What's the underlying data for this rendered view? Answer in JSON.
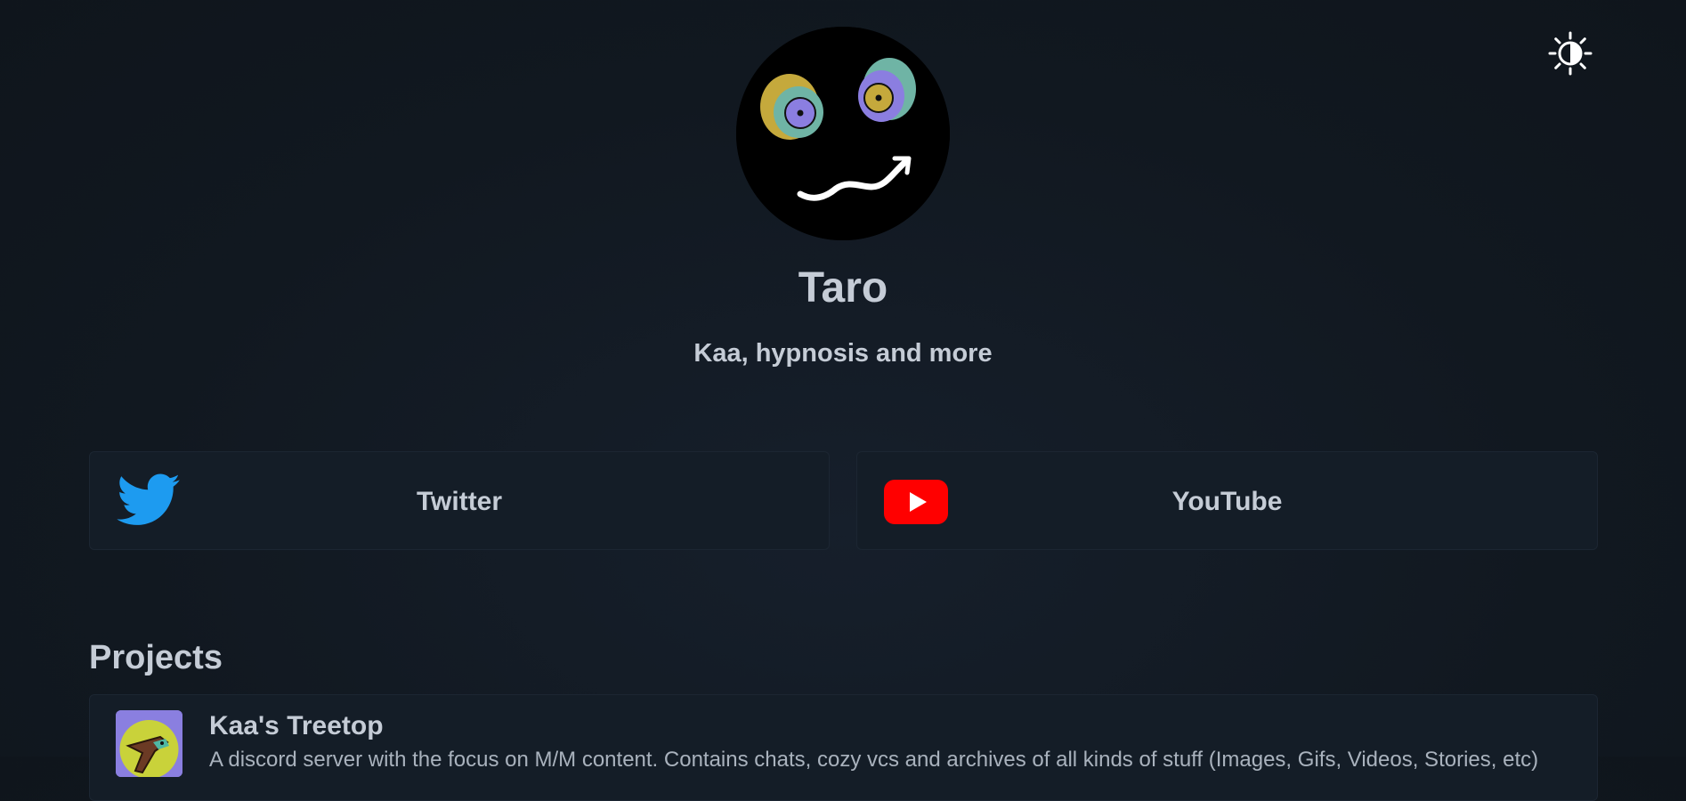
{
  "profile": {
    "name": "Taro",
    "tagline": "Kaa, hypnosis and more",
    "avatar_icon": "hypno-face-avatar"
  },
  "theme_toggle": {
    "icon": "brightness-half-icon"
  },
  "links": [
    {
      "label": "Twitter",
      "icon": "twitter-bird-icon",
      "color": "#1d9bf0"
    },
    {
      "label": "YouTube",
      "icon": "youtube-play-icon",
      "color": "#ff0000"
    }
  ],
  "projects_section": {
    "title": "Projects",
    "items": [
      {
        "title": "Kaa's Treetop",
        "description": "A discord server with the focus on M/M content. Contains chats, cozy vcs and archives of all kinds of stuff (Images, Gifs, Videos, Stories, etc)",
        "thumb_icon": "kaas-treetop-logo"
      }
    ]
  },
  "colors": {
    "background": "#111820",
    "card": "#141d27",
    "text": "#c5ccd6"
  }
}
